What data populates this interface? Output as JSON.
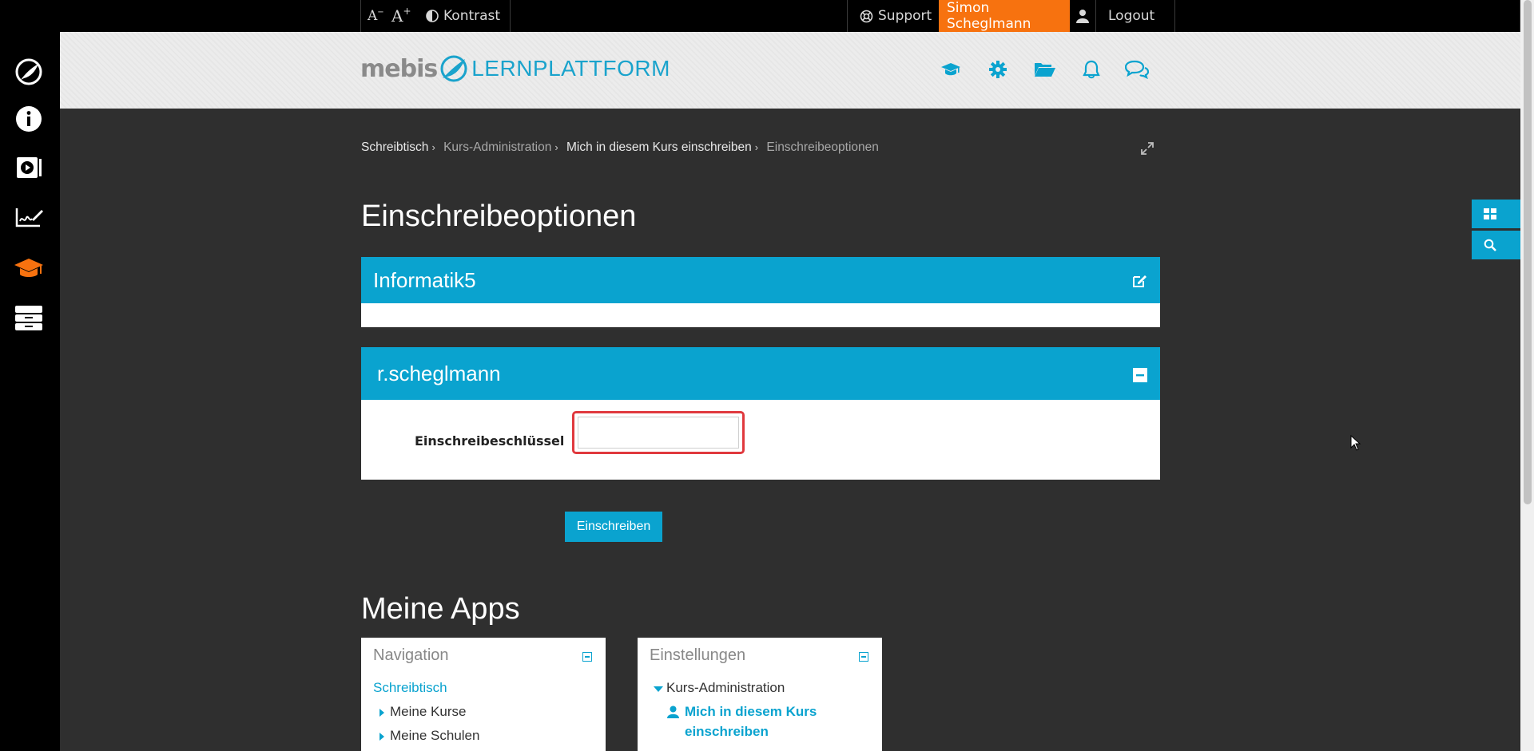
{
  "topbar": {
    "font_decrease_label": "A",
    "font_increase_label": "A",
    "contrast_label": "Kontrast",
    "support_label": "Support",
    "user_name": "Simon Scheglmann",
    "logout_label": "Logout"
  },
  "header": {
    "logo_brand": "mebis",
    "logo_product": "LERNPLATTFORM",
    "icons": [
      "graduation-cap-icon",
      "gear-icon",
      "folder-open-icon",
      "bell-icon",
      "chat-bubbles-icon"
    ]
  },
  "breadcrumb": {
    "items": [
      "Schreibtisch",
      "Kurs-Administration",
      "Mich in diesem Kurs einschreiben",
      "Einschreibeoptionen"
    ],
    "separator": "›"
  },
  "main": {
    "page_title": "Einschreibeoptionen",
    "course_panel_title": "Informatik5",
    "enrol_panel_title": "r.scheglmann",
    "enrol_key_label": "Einschreibeschlüssel",
    "enrol_key_value": "",
    "submit_label": "Einschreiben",
    "apps_title": "Meine Apps"
  },
  "navigation_block": {
    "title": "Navigation",
    "root_link": "Schreibtisch",
    "items": [
      "Meine Kurse",
      "Meine Schulen"
    ]
  },
  "settings_block": {
    "title": "Einstellungen",
    "section": "Kurs-Administration",
    "link_line1": "Mich in diesem Kurs",
    "link_line2": "einschreiben"
  },
  "colors": {
    "accent_blue": "#0aa3cf",
    "user_orange": "#f7720f",
    "background": "#2f2f2f",
    "highlight_red": "#e0393e"
  }
}
